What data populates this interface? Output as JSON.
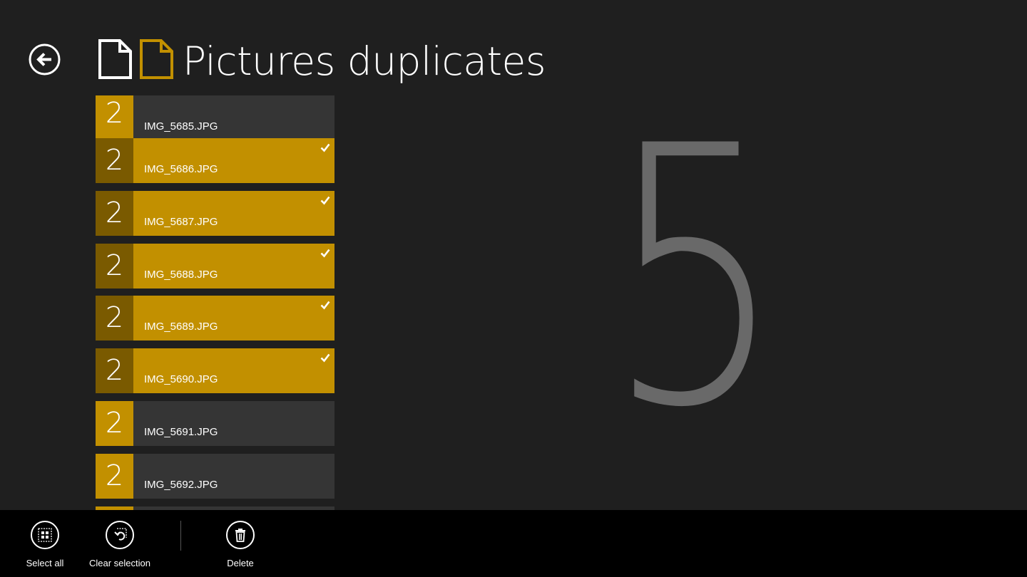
{
  "header": {
    "title": "Pictures duplicates",
    "back_icon": "back-arrow-icon",
    "title_icons": [
      "document-icon",
      "document-duplicate-icon"
    ]
  },
  "colors": {
    "accent": "#c29000",
    "accent_dark": "#7a5a00",
    "background": "#1f1f1f",
    "item_background": "#353535",
    "app_bar": "#000000",
    "big_count": "#696969"
  },
  "files": [
    {
      "count": "2",
      "name": "IMG_5685.JPG",
      "selected": false
    },
    {
      "count": "2",
      "name": "IMG_5686.JPG",
      "selected": true
    },
    {
      "count": "2",
      "name": "IMG_5687.JPG",
      "selected": true
    },
    {
      "count": "2",
      "name": "IMG_5688.JPG",
      "selected": true
    },
    {
      "count": "2",
      "name": "IMG_5689.JPG",
      "selected": true
    },
    {
      "count": "2",
      "name": "IMG_5690.JPG",
      "selected": true
    },
    {
      "count": "2",
      "name": "IMG_5691.JPG",
      "selected": false
    },
    {
      "count": "2",
      "name": "IMG_5692.JPG",
      "selected": false
    }
  ],
  "selected_count": "5",
  "app_bar": {
    "select_all": {
      "label": "Select all",
      "icon": "select-all-icon"
    },
    "clear_selection": {
      "label": "Clear selection",
      "icon": "clear-selection-icon"
    },
    "delete": {
      "label": "Delete",
      "icon": "trash-icon"
    }
  }
}
